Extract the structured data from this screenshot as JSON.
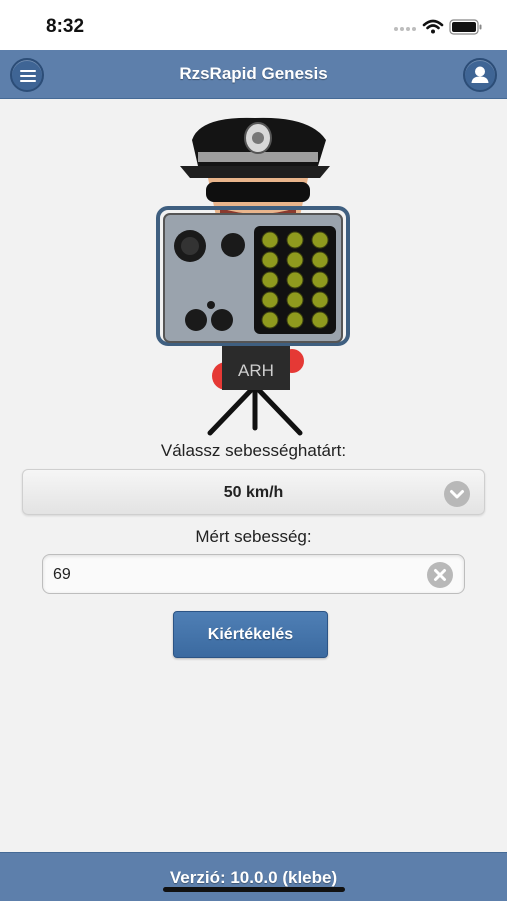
{
  "status_bar": {
    "time": "8:32",
    "icons": [
      "cellular-dots-icon",
      "wifi-icon",
      "battery-icon"
    ]
  },
  "header": {
    "title": "RzsRapid Genesis",
    "menu_icon": "hamburger-menu-icon",
    "user_icon": "user-icon"
  },
  "illustration": {
    "device_label": "ARH"
  },
  "form": {
    "speed_limit_label": "Válassz sebességhatárt:",
    "speed_limit_value": "50 km/h",
    "measured_label": "Mért sebesség:",
    "measured_value": "69",
    "evaluate_label": "Kiértékelés"
  },
  "footer": {
    "version_text": "Verzió: 10.0.0 (klebe)"
  },
  "colors": {
    "header_bg": "#5d7fab",
    "button_bg": "#3b6aa0",
    "page_bg": "#f2f2f2"
  }
}
